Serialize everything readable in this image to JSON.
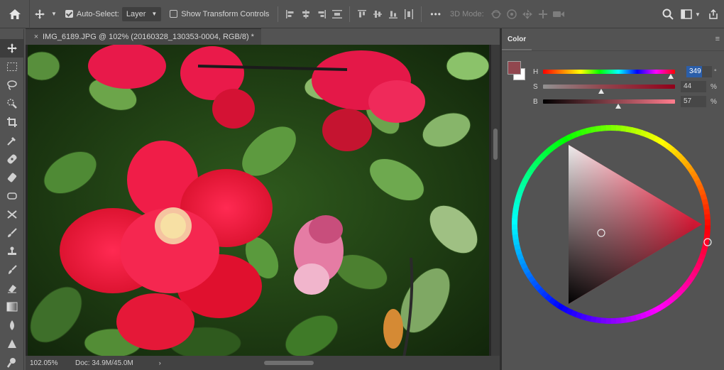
{
  "options_bar": {
    "auto_select_label": "Auto-Select:",
    "layer_select_value": "Layer",
    "transform_label": "Show Transform Controls",
    "more_label": "•••",
    "mode_label": "3D Mode:"
  },
  "document": {
    "tab_title": "IMG_6189.JPG @ 102% (20160328_130353-0004, RGB/8) *",
    "zoom": "102.05%",
    "doc_size": "Doc: 34.9M/45.0M"
  },
  "color_panel": {
    "tab_label": "Color",
    "menu_icon": "≡",
    "foreground_color": "#91474F",
    "background_color": "#FFFFFF",
    "hue_label": "H",
    "hue_value": "349",
    "hue_unit": "°",
    "saturation_label": "S",
    "saturation_value": "44",
    "saturation_unit": "%",
    "brightness_label": "B",
    "brightness_value": "57",
    "brightness_unit": "%",
    "hue_level": 0.97,
    "saturation_level": 0.44,
    "brightness_level": 0.57
  }
}
